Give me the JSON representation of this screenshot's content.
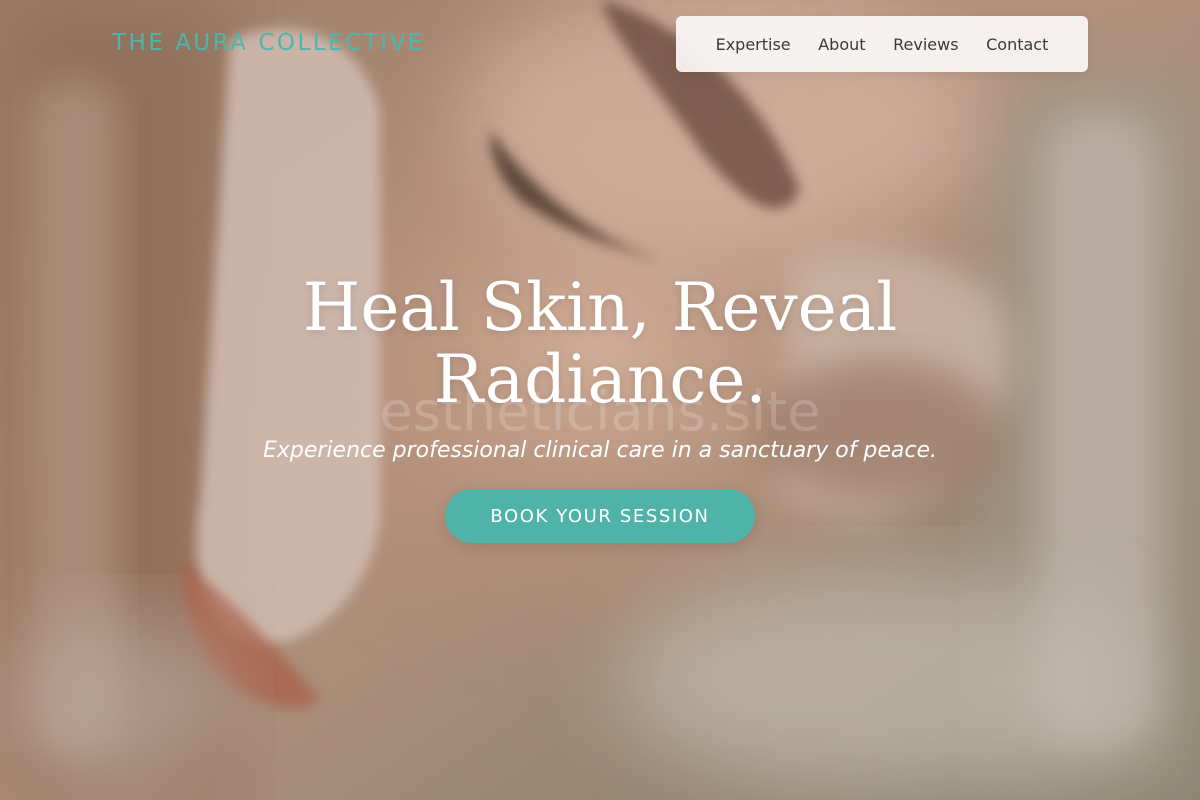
{
  "header": {
    "brand": "THE AURA COLLECTIVE",
    "nav": [
      "Expertise",
      "About",
      "Reviews",
      "Contact"
    ]
  },
  "hero": {
    "headline_line1": "Heal Skin, Reveal",
    "headline_line2": "Radiance.",
    "watermark": "estheticians.site",
    "subtitle": "Experience professional clinical care in a sanctuary of peace.",
    "cta_label": "BOOK YOUR SESSION",
    "background_image": "blurred-facial-treatment-photo"
  },
  "colors": {
    "accent": "#4FB3A9",
    "brand_text": "#4DB6AC",
    "nav_bg": "#FAF8F6",
    "nav_text": "#3A3A3A",
    "hero_text": "#FFFFFF"
  }
}
